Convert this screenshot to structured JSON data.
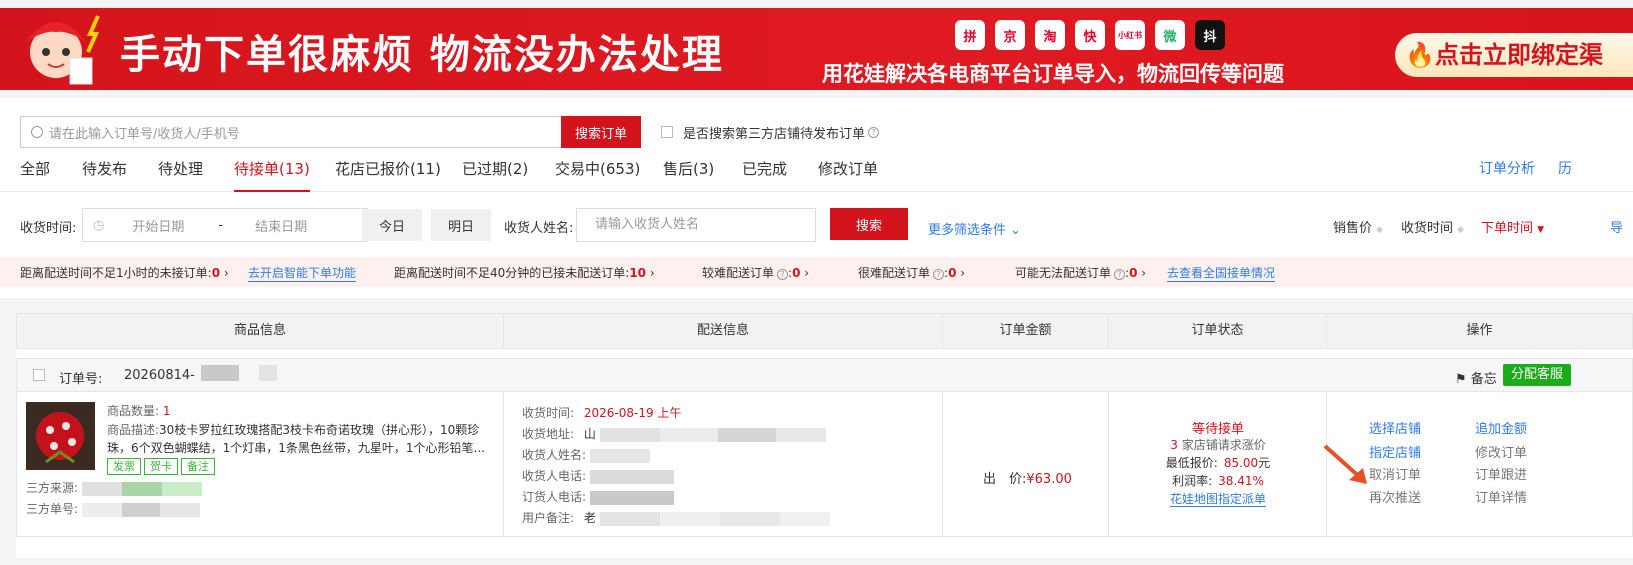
{
  "banner": {
    "headline": "手动下单很麻烦 物流没办法处理",
    "subline": "用花娃解决各电商平台订单导入，物流回传等问题",
    "bind_label": "点击立即绑定渠",
    "platforms": [
      "拼",
      "京",
      "淘",
      "快",
      "小红书",
      "微",
      "抖"
    ]
  },
  "search": {
    "placeholder": "请在此输入订单号/收货人/手机号",
    "button": "搜索订单",
    "third_party_label": "是否搜索第三方店铺待发布订单"
  },
  "tabs": [
    "全部",
    "待发布",
    "待处理",
    "待接单(13)",
    "花店已报价(11)",
    "已过期(2)",
    "交易中(653)",
    "售后(3)",
    "已完成",
    "修改订单"
  ],
  "active_tab": "待接单(13)",
  "right_tabs": [
    "订单分析",
    "历"
  ],
  "filters": {
    "receive_time_label": "收货时间:",
    "start_placeholder": "开始日期",
    "dash": "-",
    "end_placeholder": "结束日期",
    "today": "今日",
    "tomorrow": "明日",
    "receiver_label": "收货人姓名:",
    "receiver_placeholder": "请输入收货人姓名",
    "search_button": "搜索",
    "more_filters": "更多筛选条件",
    "sort_price": "销售价",
    "sort_receive": "收货时间",
    "sort_order": "下单时间",
    "right_cut": "导"
  },
  "alerts": {
    "a1_label": "距离配送时间不足1小时的未接订单:",
    "a1_value": "0",
    "a1_link": "去开启智能下单功能",
    "a2_label": "距离配送时间不足40分钟的已接未配送订单:",
    "a2_value": "10",
    "a3_label": "较难配送订单",
    "a3_value": "0",
    "a4_label": "很难配送订单",
    "a4_value": "0",
    "a5_label": "可能无法配送订单",
    "a5_value": "0",
    "a5_link": "去查看全国接单情况"
  },
  "table": {
    "headers": [
      "商品信息",
      "配送信息",
      "订单金额",
      "订单状态",
      "操作"
    ]
  },
  "order": {
    "number_label": "订单号:",
    "number": "20260814-",
    "memo": "备忘",
    "assign": "分配客服",
    "qty_label": "商品数量:",
    "qty": "1",
    "desc_label": "商品描述:",
    "desc": "30枝卡罗拉红玫瑰搭配3枝卡布奇诺玫瑰（拼心形），10颗珍珠，6个双色蝴蝶结，1个灯串，1条黑色丝带，九星叶，1个心形铅笔...",
    "tags": [
      "发票",
      "贺卡",
      "备注"
    ],
    "source_label": "三方来源:",
    "third_no_label": "三方单号:",
    "receive_time_label": "收货时间:",
    "receive_time": "2026-08-19 上午",
    "address_label": "收货地址:",
    "address_prefix": "山",
    "receiver_label": "收货人姓名:",
    "receiver_phone_label": "收货人电话:",
    "buyer_phone_label": "订货人电话:",
    "note_label": "用户备注:",
    "note_prefix": "老",
    "price_label": "出　价:",
    "price": "¥63.00",
    "status": "等待接单",
    "request_count": "3",
    "request_text": "家店铺请求涨价",
    "min_quote_label": "最低报价:",
    "min_quote": "85.00",
    "min_quote_unit": "元",
    "profit_label": "利润率:",
    "profit": "38.41%",
    "map_link": "花娃地图指定派单",
    "ops": {
      "select_shop": "选择店铺",
      "add_amount": "追加金额",
      "assign_shop": "指定店铺",
      "modify_order": "修改订单",
      "cancel_order": "取消订单",
      "track_order": "订单跟进",
      "repush": "再次推送",
      "order_detail": "订单详情"
    }
  }
}
